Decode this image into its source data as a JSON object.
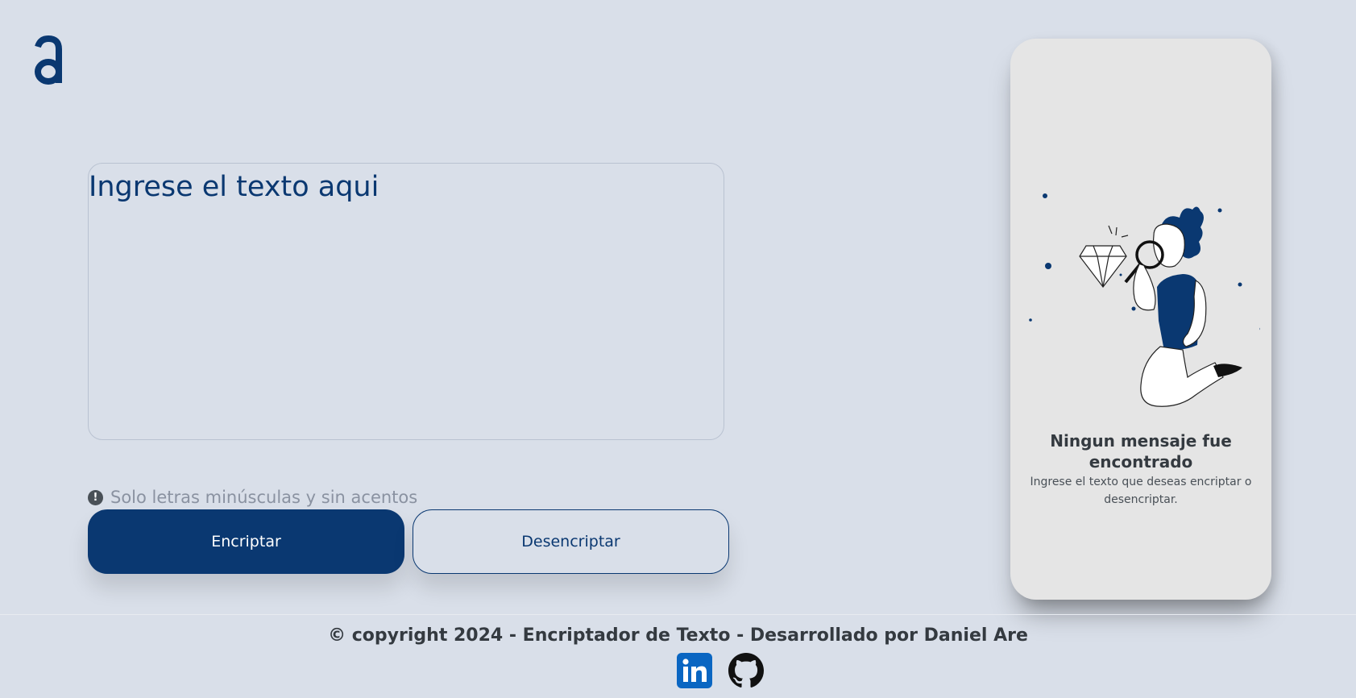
{
  "logo": {
    "icon": "alura-logo-icon",
    "glyph": "a"
  },
  "input": {
    "placeholder": "Ingrese el texto aqui"
  },
  "hint": {
    "icon": "exclamation-circle-icon",
    "text": "Solo letras minúsculas y sin acentos"
  },
  "buttons": {
    "encrypt_label": "Encriptar",
    "decrypt_label": "Desencriptar"
  },
  "output_panel": {
    "illustration": "person-with-magnifying-glass-illustration",
    "title": "Ningun mensaje fue encontrado",
    "subtitle": "Ingrese el texto que deseas encriptar o desencriptar."
  },
  "footer": {
    "copyright": "© copyright 2024 - Encriptador de Texto - Desarrollado por Daniel Are",
    "links": [
      {
        "name": "linkedin",
        "icon": "linkedin-icon"
      },
      {
        "name": "github",
        "icon": "github-icon"
      }
    ]
  },
  "colors": {
    "background": "#d9dfe9",
    "primary": "#0a3871",
    "panel": "#e5e5e5",
    "text_dark": "#343a40",
    "muted": "#8a92a1",
    "linkedin": "#0a66c2"
  }
}
